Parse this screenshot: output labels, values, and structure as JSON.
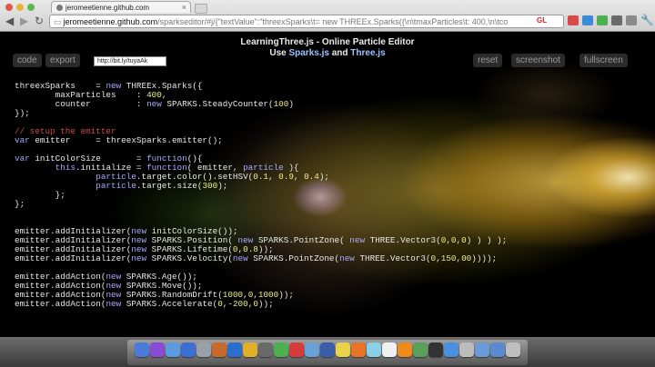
{
  "browser": {
    "tab_title": "jeromeetienne.github.com",
    "address": {
      "domain": "jeromeetienne.github.com",
      "path": "/sparkseditor/#j/{\"textValue\":\"threexSparks\\t= new THREEx.Sparks({\\n\\tmaxParticles\\t: 400,\\n\\tco"
    },
    "gl_badge": "GL"
  },
  "page": {
    "header": {
      "title_plain": "LearningThree.js - Online Particle Editor",
      "line2_prefix": "Use ",
      "link1": "Sparks.js",
      "line2_mid": " and ",
      "link2": "Three.js"
    },
    "buttons": {
      "code": "code",
      "export": "export",
      "reset": "reset",
      "screenshot": "screenshot",
      "fullscreen": "fullscreen"
    },
    "short_url": "http://bit.ly/tuyaAk",
    "code_lines": [
      "threexSparks    = new THREEx.Sparks({",
      "        maxParticles    : 400,",
      "        counter         : new SPARKS.SteadyCounter(100)",
      "});",
      "",
      "// setup the emitter",
      "var emitter     = threexSparks.emitter();",
      "",
      "var initColorSize       = function(){",
      "        this.initialize = function( emitter, particle ){",
      "                particle.target.color().setHSV(0.1, 0.9, 0.4);",
      "                particle.target.size(300);",
      "        };",
      "};",
      "",
      "",
      "emitter.addInitializer(new initColorSize());",
      "emitter.addInitializer(new SPARKS.Position( new SPARKS.PointZone( new THREE.Vector3(0,0,0) ) ) );",
      "emitter.addInitializer(new SPARKS.Lifetime(0,0.8));",
      "emitter.addInitializer(new SPARKS.Velocity(new SPARKS.PointZone(new THREE.Vector3(0,150,00))));",
      "",
      "emitter.addAction(new SPARKS.Age());",
      "emitter.addAction(new SPARKS.Move());",
      "emitter.addAction(new SPARKS.RandomDrift(1000,0,1000));",
      "emitter.addAction(new SPARKS.Accelerate(0,-200,0));"
    ]
  },
  "dock": {
    "icons": [
      "finder-icon",
      "itunes-icon",
      "mail-icon",
      "safari-icon",
      "settings-icon",
      "photo-icon",
      "dashboard-icon",
      "terminal-icon",
      "app-icon",
      "chrome-icon",
      "calendar-icon",
      "preview-icon",
      "xcode-icon",
      "notes-icon",
      "firefox-icon",
      "monitor-icon",
      "textedit-icon",
      "vlc-icon",
      "activity-icon",
      "console-icon",
      "safari2-icon",
      "camera-icon",
      "folder-icon",
      "downloads-icon",
      "trash-icon"
    ],
    "colors": [
      "#4a7bd8",
      "#8a4ad8",
      "#5b9be0",
      "#3b6fd6",
      "#9aa0a8",
      "#c96a2b",
      "#2a6fd0",
      "#e0b02a",
      "#6a6a6a",
      "#4caf50",
      "#d83b3b",
      "#6aa0d8",
      "#3a5fa8",
      "#e8d24a",
      "#e8742a",
      "#8ad0e8",
      "#f0f0f0",
      "#f08a1a",
      "#5aa05a",
      "#333333",
      "#4a90e2",
      "#bcbcbc",
      "#6a9ad8",
      "#5a8ad0",
      "#bfbfbf"
    ]
  }
}
